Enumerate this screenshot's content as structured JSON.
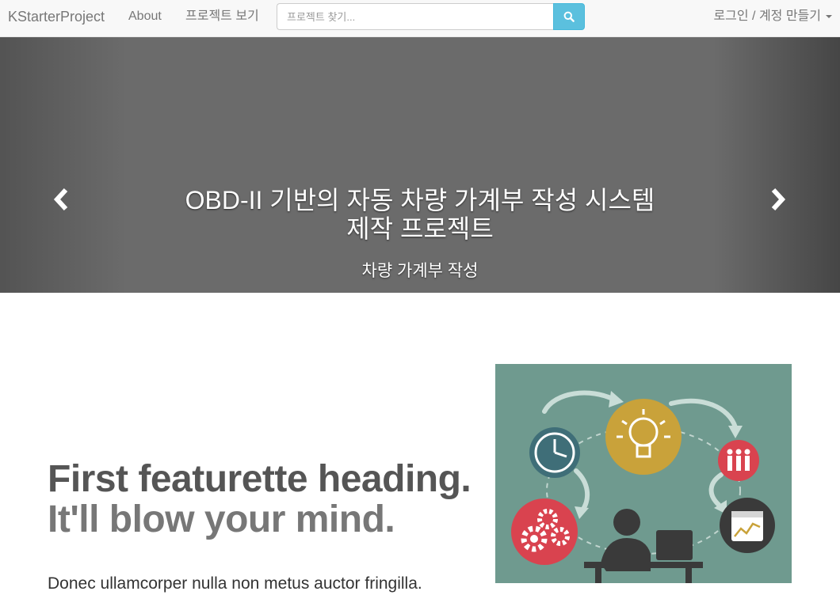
{
  "navbar": {
    "brand": "KStarterProject",
    "about": "About",
    "projects": "프로젝트 보기",
    "search_placeholder": "프로젝트 찾기...",
    "search_icon": "search-icon",
    "account": "로그인 / 계정 만들기"
  },
  "carousel": {
    "title_line1": "OBD-II 기반의 자동 차량 가계부 작성 시스템",
    "title_line2": "제작 프로젝트",
    "subtitle": "차량 가계부 작성",
    "prev_icon": "chevron-left-icon",
    "next_icon": "chevron-right-icon"
  },
  "featurette": {
    "heading": "First featurette heading.",
    "heading_muted": "It'll blow your mind.",
    "text": "Donec ullamcorper nulla non metus auctor fringilla."
  },
  "colors": {
    "navbar_bg": "#f8f8f8",
    "search_btn": "#5bc0de",
    "carousel_bg": "#6b6b6b",
    "illustration_bg": "#6f9a8f",
    "bulb": "#c9a23a",
    "red_accent": "#d9434f",
    "clock": "#3f6e78",
    "dark": "#3a3a3a"
  }
}
